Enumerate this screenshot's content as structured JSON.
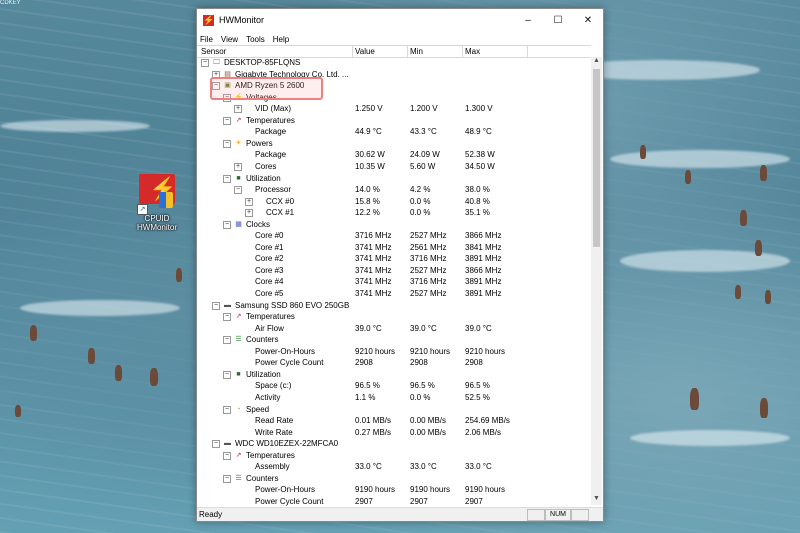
{
  "desktop": {
    "corner_label": "CDKEY",
    "icon_label_line1": "CPUID",
    "icon_label_line2": "HWMonitor"
  },
  "window": {
    "title": "HWMonitor",
    "menu": [
      "File",
      "View",
      "Tools",
      "Help"
    ],
    "columns": [
      "Sensor",
      "Value",
      "Min",
      "Max"
    ],
    "status": {
      "ready": "Ready",
      "num": "NUM"
    }
  },
  "rows": [
    {
      "d": 0,
      "icon": "computer-icon",
      "name": "DESKTOP-85FLQNS",
      "exp": "-"
    },
    {
      "d": 1,
      "icon": "motherboard-icon",
      "name": "Gigabyte Technology Co. Ltd. ...",
      "exp": "+"
    },
    {
      "d": 1,
      "icon": "cpu-icon",
      "name": "AMD Ryzen 5 2600",
      "exp": "-"
    },
    {
      "d": 2,
      "icon": "voltage-icon",
      "name": "Voltages",
      "exp": "-"
    },
    {
      "d": 3,
      "name": "VID (Max)",
      "v": "1.250 V",
      "min": "1.200 V",
      "max": "1.300 V",
      "exp": "+"
    },
    {
      "d": 2,
      "icon": "temperature-icon",
      "name": "Temperatures",
      "exp": "-"
    },
    {
      "d": 3,
      "name": "Package",
      "v": "44.9 °C",
      "min": "43.3 °C",
      "max": "48.9 °C"
    },
    {
      "d": 2,
      "icon": "power-icon",
      "name": "Powers",
      "exp": "-"
    },
    {
      "d": 3,
      "name": "Package",
      "v": "30.62 W",
      "min": "24.09 W",
      "max": "52.38 W"
    },
    {
      "d": 3,
      "name": "Cores",
      "v": "10.35 W",
      "min": "5.60 W",
      "max": "34.50 W",
      "exp": "+"
    },
    {
      "d": 2,
      "icon": "utilization-icon",
      "name": "Utilization",
      "exp": "-"
    },
    {
      "d": 3,
      "name": "Processor",
      "v": "14.0 %",
      "min": "4.2 %",
      "max": "38.0 %",
      "exp": "-"
    },
    {
      "d": 4,
      "name": "CCX #0",
      "v": "15.8 %",
      "min": "0.0 %",
      "max": "40.8 %",
      "exp": "+"
    },
    {
      "d": 4,
      "name": "CCX #1",
      "v": "12.2 %",
      "min": "0.0 %",
      "max": "35.1 %",
      "exp": "+"
    },
    {
      "d": 2,
      "icon": "clock-icon",
      "name": "Clocks",
      "exp": "-"
    },
    {
      "d": 3,
      "name": "Core #0",
      "v": "3716 MHz",
      "min": "2527 MHz",
      "max": "3866 MHz"
    },
    {
      "d": 3,
      "name": "Core #1",
      "v": "3741 MHz",
      "min": "2561 MHz",
      "max": "3841 MHz"
    },
    {
      "d": 3,
      "name": "Core #2",
      "v": "3741 MHz",
      "min": "3716 MHz",
      "max": "3891 MHz"
    },
    {
      "d": 3,
      "name": "Core #3",
      "v": "3741 MHz",
      "min": "2527 MHz",
      "max": "3866 MHz"
    },
    {
      "d": 3,
      "name": "Core #4",
      "v": "3741 MHz",
      "min": "3716 MHz",
      "max": "3891 MHz"
    },
    {
      "d": 3,
      "name": "Core #5",
      "v": "3741 MHz",
      "min": "2527 MHz",
      "max": "3891 MHz"
    },
    {
      "d": 1,
      "icon": "drive-icon",
      "name": "Samsung SSD 860 EVO 250GB",
      "exp": "-"
    },
    {
      "d": 2,
      "icon": "temperature-icon",
      "name": "Temperatures",
      "exp": "-"
    },
    {
      "d": 3,
      "name": "Air Flow",
      "v": "39.0 °C",
      "min": "39.0 °C",
      "max": "39.0 °C"
    },
    {
      "d": 2,
      "icon": "counter-icon",
      "name": "Counters",
      "exp": "-"
    },
    {
      "d": 3,
      "name": "Power-On-Hours",
      "v": "9210 hours",
      "min": "9210 hours",
      "max": "9210 hours"
    },
    {
      "d": 3,
      "name": "Power Cycle Count",
      "v": "2908",
      "min": "2908",
      "max": "2908"
    },
    {
      "d": 2,
      "icon": "utilization-icon",
      "name": "Utilization",
      "exp": "-"
    },
    {
      "d": 3,
      "name": "Space (c:)",
      "v": "96.5 %",
      "min": "96.5 %",
      "max": "96.5 %"
    },
    {
      "d": 3,
      "name": "Activity",
      "v": "1.1 %",
      "min": "0.0 %",
      "max": "52.5 %"
    },
    {
      "d": 2,
      "icon": "speed-icon",
      "name": "Speed",
      "exp": "-"
    },
    {
      "d": 3,
      "name": "Read Rate",
      "v": "0.01 MB/s",
      "min": "0.00 MB/s",
      "max": "254.69 MB/s"
    },
    {
      "d": 3,
      "name": "Write Rate",
      "v": "0.27 MB/s",
      "min": "0.00 MB/s",
      "max": "2.06 MB/s"
    },
    {
      "d": 1,
      "icon": "drive-icon",
      "name": "WDC WD10EZEX-22MFCA0",
      "exp": "-"
    },
    {
      "d": 2,
      "icon": "temperature-icon",
      "name": "Temperatures",
      "exp": "-"
    },
    {
      "d": 3,
      "name": "Assembly",
      "v": "33.0 °C",
      "min": "33.0 °C",
      "max": "33.0 °C"
    },
    {
      "d": 2,
      "icon": "counter-icon",
      "name": "Counters",
      "exp": "-"
    },
    {
      "d": 3,
      "name": "Power-On-Hours",
      "v": "9190 hours",
      "min": "9190 hours",
      "max": "9190 hours"
    },
    {
      "d": 3,
      "name": "Power Cycle Count",
      "v": "2907",
      "min": "2907",
      "max": "2907"
    }
  ]
}
